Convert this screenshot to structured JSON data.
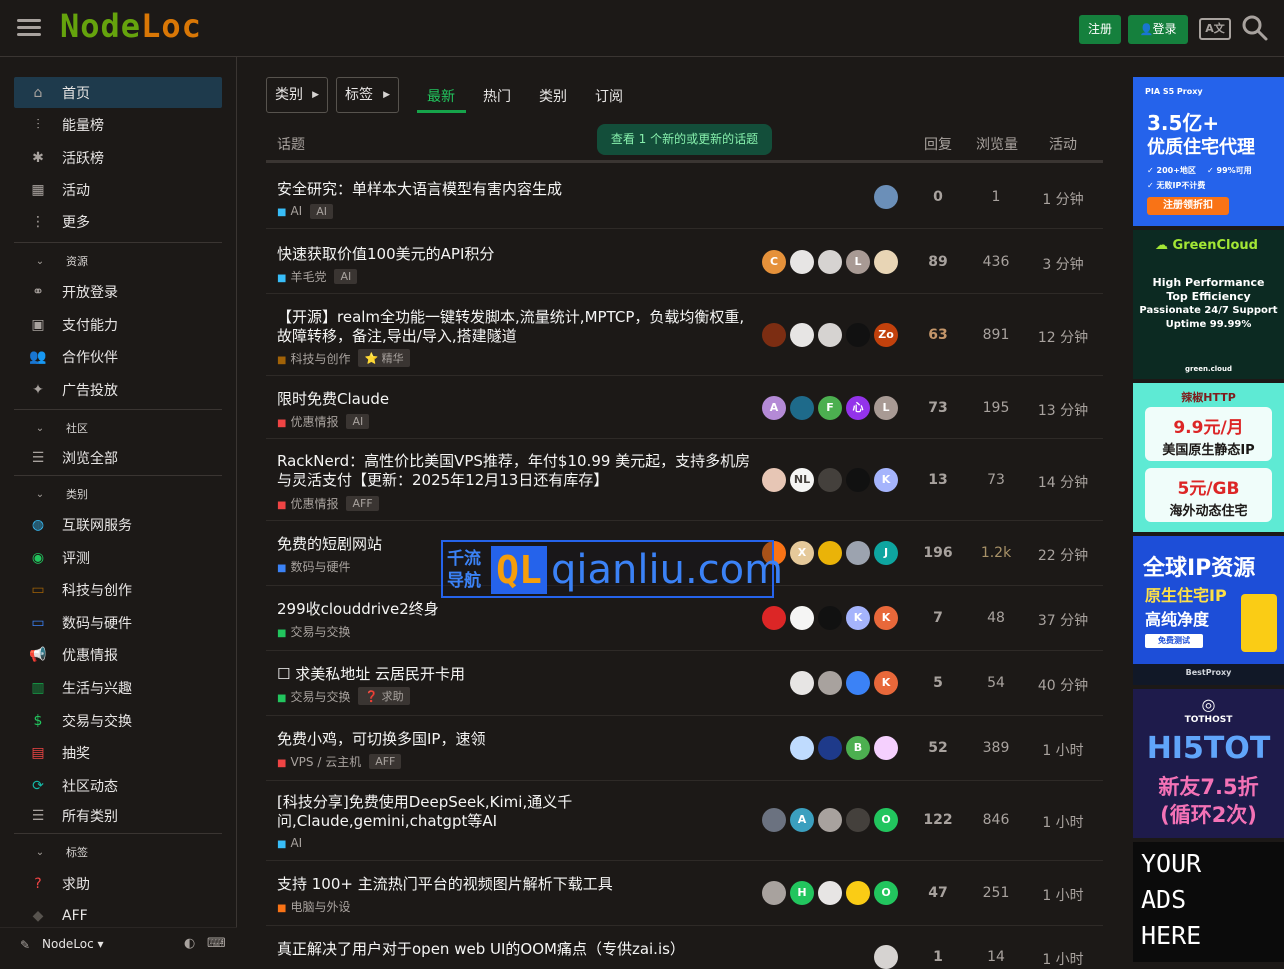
{
  "header": {
    "logo_part1": "Node",
    "logo_part2": "Loc",
    "register_label": "注册",
    "login_label": "登录",
    "lang_icon_label": "A文"
  },
  "sidebar": {
    "main_items": [
      {
        "label": "首页",
        "icon": "home-icon"
      },
      {
        "label": "能量榜",
        "icon": "bar-chart-icon"
      },
      {
        "label": "活跃榜",
        "icon": "asterisk-icon"
      },
      {
        "label": "活动",
        "icon": "calendar-icon"
      },
      {
        "label": "更多",
        "icon": "more-vertical-icon"
      }
    ],
    "section_resources": "资源",
    "resources": [
      {
        "label": "开放登录",
        "icon": "link-icon"
      },
      {
        "label": "支付能力",
        "icon": "payment-icon"
      },
      {
        "label": "合作伙伴",
        "icon": "users-icon"
      },
      {
        "label": "广告投放",
        "icon": "sparkle-icon"
      }
    ],
    "section_community": "社区",
    "community": [
      {
        "label": "浏览全部",
        "icon": "list-icon"
      }
    ],
    "section_categories": "类别",
    "categories": [
      {
        "label": "互联网服务",
        "icon": "globe-icon",
        "color": "#38bdf8"
      },
      {
        "label": "评测",
        "icon": "eye-icon",
        "color": "#22c55e"
      },
      {
        "label": "科技与创作",
        "icon": "ruler-icon",
        "color": "#a16207"
      },
      {
        "label": "数码与硬件",
        "icon": "monitor-icon",
        "color": "#3b82f6"
      },
      {
        "label": "优惠情报",
        "icon": "megaphone-icon",
        "color": "#ef4444"
      },
      {
        "label": "生活与兴趣",
        "icon": "building-icon",
        "color": "#16a34a"
      },
      {
        "label": "交易与交换",
        "icon": "dollar-icon",
        "color": "#22c55e"
      },
      {
        "label": "抽奖",
        "icon": "gift-icon",
        "color": "#ef4444"
      },
      {
        "label": "社区动态",
        "icon": "refresh-icon",
        "color": "#14b8a6"
      },
      {
        "label": "所有类别",
        "icon": "list-icon",
        "color": "#a8a29e"
      }
    ],
    "section_tags": "标签",
    "tags": [
      {
        "label": "求助",
        "icon": "question-icon",
        "color": "#ef4444"
      },
      {
        "label": "AFF",
        "icon": "tag-icon",
        "color": "#57534e"
      }
    ],
    "footer_site": "NodeLoc"
  },
  "filters": {
    "category_label": "类别",
    "tag_label": "标签",
    "tabs": [
      "最新",
      "热门",
      "类别",
      "订阅"
    ]
  },
  "list": {
    "col_topic": "话题",
    "col_replies": "回复",
    "col_views": "浏览量",
    "col_activity": "活动",
    "new_topics_banner": "查看 1 个新的或更新的话题",
    "topics": [
      {
        "title": "安全研究：单样本大语言模型有害内容生成",
        "category": "AI",
        "category_color": "#38bdf8",
        "tags": [
          "AI"
        ],
        "avatars": [
          {
            "t": "",
            "c": "#6b8fb8"
          }
        ],
        "replies": "0",
        "views": "1",
        "activity": "1 分钟"
      },
      {
        "title": "快速获取价值100美元的API积分",
        "category": "羊毛党",
        "category_color": "#38bdf8",
        "tags": [
          "AI"
        ],
        "avatars": [
          {
            "t": "C",
            "c": "#e5913a"
          },
          {
            "t": "",
            "c": "#e7e5e4"
          },
          {
            "t": "",
            "c": "#d6d3d1"
          },
          {
            "t": "L",
            "c": "#a89a94"
          },
          {
            "t": "",
            "c": "#e8d5b5"
          }
        ],
        "replies": "89",
        "views": "436",
        "activity": "3 分钟"
      },
      {
        "title": "【开源】realm全功能一键转发脚本,流量统计,MPTCP，负载均衡权重,故障转移，备注,导出/导入,搭建隧道",
        "category": "科技与创作",
        "category_color": "#a16207",
        "tags": [
          "⭐ 精华"
        ],
        "avatars": [
          {
            "t": "",
            "c": "#7c2d12"
          },
          {
            "t": "",
            "c": "#e7e5e4"
          },
          {
            "t": "",
            "c": "#d6d3d1"
          },
          {
            "t": "",
            "c": "#111111"
          },
          {
            "t": "Zo",
            "c": "#c2410c"
          }
        ],
        "replies": "63",
        "views": "891",
        "activity": "12 分钟"
      },
      {
        "title": "限时免费Claude",
        "category": "优惠情报",
        "category_color": "#ef4444",
        "tags": [
          "AI"
        ],
        "avatars": [
          {
            "t": "A",
            "c": "#b48ad6"
          },
          {
            "t": "",
            "c": "#1e6a8a"
          },
          {
            "t": "F",
            "c": "#4caf50"
          },
          {
            "t": "心",
            "c": "#9333ea"
          },
          {
            "t": "L",
            "c": "#a89a94"
          }
        ],
        "replies": "73",
        "views": "195",
        "activity": "13 分钟"
      },
      {
        "title": "RackNerd：高性价比美国VPS推荐，年付$10.99 美元起，支持多机房与灵活支付【更新：2025年12月13日还有库存】",
        "category": "优惠情报",
        "category_color": "#ef4444",
        "tags": [
          "AFF"
        ],
        "avatars": [
          {
            "t": "",
            "c": "#e7c6b5"
          },
          {
            "t": "NL",
            "c": "#f5f5f4"
          },
          {
            "t": "",
            "c": "#44403c"
          },
          {
            "t": "",
            "c": "#111111"
          },
          {
            "t": "K",
            "c": "#a5b4fc"
          }
        ],
        "replies": "13",
        "views": "73",
        "activity": "14 分钟"
      },
      {
        "title": "免费的短剧网站",
        "category": "数码与硬件",
        "category_color": "#3b82f6",
        "tags": [],
        "avatars": [
          {
            "t": "",
            "c": "#f97316"
          },
          {
            "t": "X",
            "c": "#e5c99a"
          },
          {
            "t": "",
            "c": "#eab308"
          },
          {
            "t": "",
            "c": "#9ca3af"
          },
          {
            "t": "J",
            "c": "#0ea5a0"
          }
        ],
        "replies": "196",
        "views": "1.2k",
        "activity": "22 分钟"
      },
      {
        "title": "299收clouddrive2终身",
        "category": "交易与交换",
        "category_color": "#22c55e",
        "tags": [],
        "avatars": [
          {
            "t": "",
            "c": "#dc2626"
          },
          {
            "t": "",
            "c": "#f5f5f4"
          },
          {
            "t": "",
            "c": "#111111"
          },
          {
            "t": "K",
            "c": "#a5b4fc"
          },
          {
            "t": "K",
            "c": "#e8683a"
          }
        ],
        "replies": "7",
        "views": "48",
        "activity": "37 分钟"
      },
      {
        "title": "☐ 求美私地址 云居民开卡用",
        "category": "交易与交换",
        "category_color": "#22c55e",
        "tags": [
          "❓ 求助"
        ],
        "avatars": [
          {
            "t": "",
            "c": "#e7e5e4"
          },
          {
            "t": "",
            "c": "#a8a29e"
          },
          {
            "t": "",
            "c": "#3b82f6"
          },
          {
            "t": "K",
            "c": "#e8683a"
          }
        ],
        "replies": "5",
        "views": "54",
        "activity": "40 分钟"
      },
      {
        "title": "免费小鸡，可切换多国IP，速领",
        "category": "VPS / 云主机",
        "category_color": "#ef4444",
        "tags": [
          "AFF"
        ],
        "avatars": [
          {
            "t": "",
            "c": "#bfdbfe"
          },
          {
            "t": "",
            "c": "#1e3a8a"
          },
          {
            "t": "B",
            "c": "#4caf50"
          },
          {
            "t": "",
            "c": "#f5d0fe"
          }
        ],
        "replies": "52",
        "views": "389",
        "activity": "1 小时"
      },
      {
        "title": "[科技分享]免费使用DeepSeek,Kimi,通义千问,Claude,gemini,chatgpt等AI",
        "category": "AI",
        "category_color": "#38bdf8",
        "tags": [],
        "avatars": [
          {
            "t": "",
            "c": "#6b7280"
          },
          {
            "t": "A",
            "c": "#3b9fbf"
          },
          {
            "t": "",
            "c": "#a8a29e"
          },
          {
            "t": "",
            "c": "#44403c"
          },
          {
            "t": "O",
            "c": "#22c55e"
          }
        ],
        "replies": "122",
        "views": "846",
        "activity": "1 小时"
      },
      {
        "title": "支持 100+ 主流热门平台的视频图片解析下载工具",
        "category": "电脑与外设",
        "category_color": "#f97316",
        "tags": [],
        "avatars": [
          {
            "t": "",
            "c": "#a8a29e"
          },
          {
            "t": "H",
            "c": "#22c55e"
          },
          {
            "t": "",
            "c": "#e7e5e4"
          },
          {
            "t": "",
            "c": "#facc15"
          },
          {
            "t": "O",
            "c": "#22c55e"
          }
        ],
        "replies": "47",
        "views": "251",
        "activity": "1 小时"
      },
      {
        "title": "真正解决了用户对于open web UI的OOM痛点（专供zai.is）",
        "category": "",
        "category_color": "#38bdf8",
        "tags": [],
        "avatars": [
          {
            "t": "",
            "c": "#d6d3d1"
          }
        ],
        "replies": "1",
        "views": "14",
        "activity": "1 小时"
      }
    ]
  },
  "ads": {
    "ad1_brand": "PIA S5 Proxy",
    "ad1_line1": "3.5亿+",
    "ad1_line2": "优质住宅代理",
    "ad1_bullet1": "200+地区",
    "ad1_bullet2": "99%可用",
    "ad1_bullet3": "无败IP不计费",
    "ad1_cta": "注册领折扣",
    "ad2_brand": "GreenCloud",
    "ad2_l1": "High Performance",
    "ad2_l2": "Top Efficiency",
    "ad2_l3": "Passionate 24/7 Support",
    "ad2_l4": "Uptime 99.99%",
    "ad2_foot": "green.cloud",
    "ad3_brand": "辣椒HTTP",
    "ad3_price1": "9.9元/月",
    "ad3_desc1": "美国原生静态IP",
    "ad3_price2": "5元/GB",
    "ad3_desc2": "海外动态住宅",
    "ad4_l1": "全球IP资源",
    "ad4_l2": "原生住宅IP",
    "ad4_l3": "高纯净度",
    "ad4_cta": "免费测试",
    "ad4_brand": "BestProxy",
    "ad5_brand": "TOTHOST",
    "ad5_l1": "HI5TOT",
    "ad5_l2": "新友7.5折",
    "ad5_l3": "(循环2次)",
    "ad6_l1": "YOUR",
    "ad6_l2": "ADS",
    "ad6_l3": "HERE"
  },
  "watermark": {
    "cn": "千流导航",
    "mark": "QL",
    "domain": "qianliu.com"
  }
}
